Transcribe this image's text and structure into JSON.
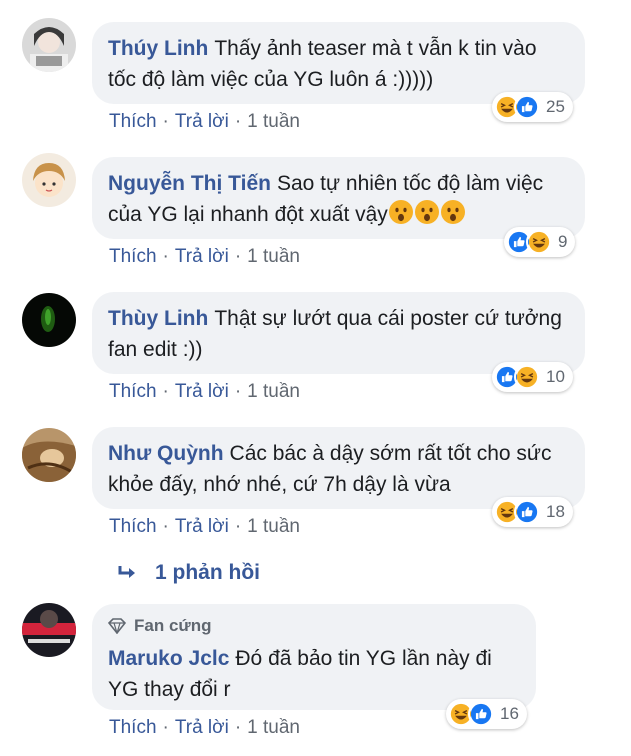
{
  "comments": [
    {
      "author": "Thúy Linh",
      "text": "Thấy ảnh teaser mà t vẫn k tin vào tốc độ làm việc của YG luôn á :)))))",
      "reactions": [
        "haha",
        "like"
      ],
      "count": "25",
      "actions": {
        "like": "Thích",
        "reply": "Trả lời",
        "time": "1 tuần"
      }
    },
    {
      "author": "Nguyễn Thị Tiến",
      "text": "Sao tự nhiên tốc độ làm việc của YG lại nhanh đột xuất vậy",
      "emojis": [
        "wow",
        "wow",
        "wow"
      ],
      "reactions": [
        "like",
        "haha"
      ],
      "count": "9",
      "actions": {
        "like": "Thích",
        "reply": "Trả lời",
        "time": "1 tuần"
      }
    },
    {
      "author": "Thùy Linh",
      "text": "Thật sự lướt qua cái poster cứ tưởng fan edit :))",
      "reactions": [
        "like",
        "haha"
      ],
      "count": "10",
      "actions": {
        "like": "Thích",
        "reply": "Trả lời",
        "time": "1 tuần"
      }
    },
    {
      "author": "Như Quỳnh",
      "text": "Các bác à dậy sớm rất tốt cho sức khỏe đấy, nhớ nhé, cứ 7h dậy là vừa",
      "reactions": [
        "haha",
        "like"
      ],
      "count": "18",
      "actions": {
        "like": "Thích",
        "reply": "Trả lời",
        "time": "1 tuần"
      }
    },
    {
      "badge": "Fan cứng",
      "author": "Maruko Jclc",
      "text": "Đó đã bảo tin YG lần này đi YG thay đổi r",
      "reactions": [
        "haha",
        "like"
      ],
      "count": "16",
      "actions": {
        "like": "Thích",
        "reply": "Trả lời",
        "time": "1 tuần"
      }
    }
  ],
  "replies_link": "1 phản hồi",
  "separator": "·",
  "colors": {
    "link": "#385898",
    "bubble": "#f0f2f5",
    "meta": "#606770",
    "like": "#1877f2",
    "haha": "#f7b125"
  }
}
